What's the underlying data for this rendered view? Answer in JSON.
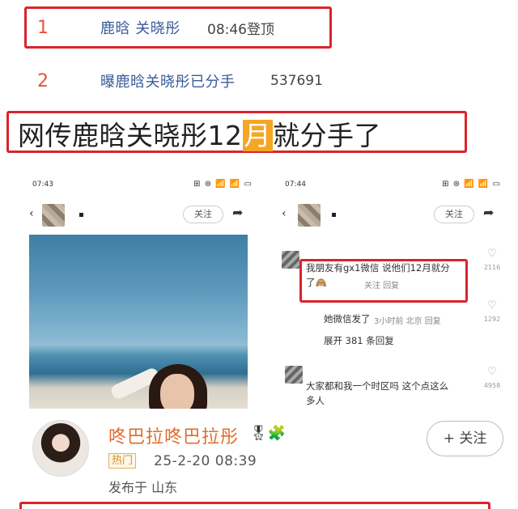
{
  "hot_search": [
    {
      "rank": "1",
      "topic": "鹿晗 关晓彤",
      "meta": "08:46登顶"
    },
    {
      "rank": "2",
      "topic": "曝鹿晗关晓彤已分手",
      "meta": "537691"
    }
  ],
  "headline": {
    "before": "网传鹿晗关晓彤12",
    "highlight": "月",
    "after": "就分手了"
  },
  "left_phone": {
    "time": "07:43",
    "status_icons": "⊞ ⊛ 📶 📶 ▭",
    "follow": "关注",
    "share_icon": "share-icon"
  },
  "right_phone": {
    "time": "07:44",
    "status_icons": "⊞ ⊛ 📶 📶 ▭",
    "follow": "关注",
    "comments": [
      {
        "text_line1": "我朋友有gx1微信 说他们12月就分",
        "text_line2": "了🙈",
        "sub": "关注 回复",
        "likes": "2116"
      },
      {
        "text_line1": "她微信发了",
        "sub": "3小时前 北京 回复",
        "likes": "1292",
        "expand": "展开 381 条回复"
      },
      {
        "text_line1": "大家都和我一个时区吗 这个点这么",
        "text_line2": "多人",
        "likes": "4958"
      }
    ]
  },
  "profile": {
    "name": "咚巴拉咚巴拉彤",
    "badges": "🎖🧩",
    "hot_tag": "热门",
    "time": "25-2-20 08:39",
    "location": "发布于 山东",
    "follow": "+ 关注"
  },
  "colors": {
    "highlight_box": "#d9242c",
    "headline_mark": "#f5a623",
    "name": "#e06d2a",
    "topic": "#3b5b9a"
  }
}
